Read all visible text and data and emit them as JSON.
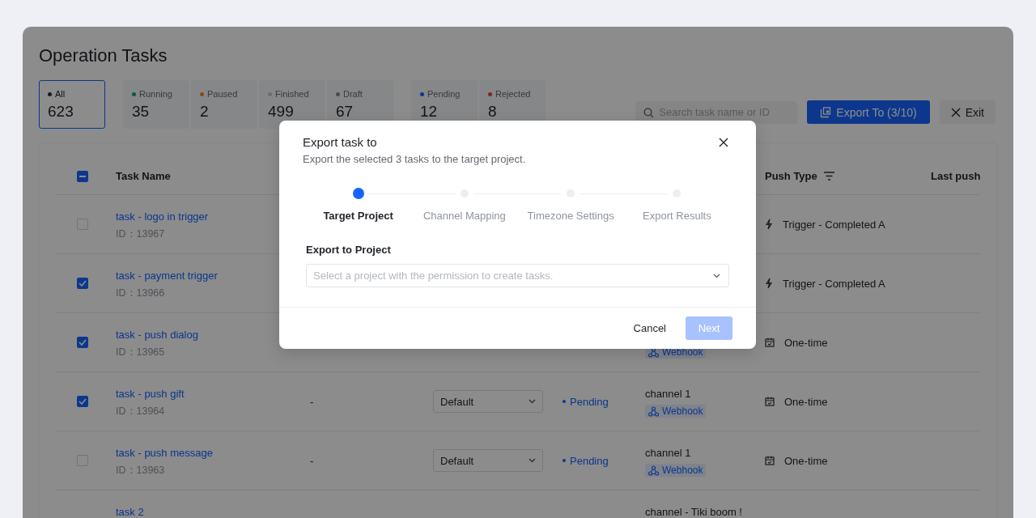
{
  "page": {
    "title": "Operation Tasks"
  },
  "stat_groups": [
    [
      {
        "label": "All",
        "count": "623",
        "color": "#1c1c1c",
        "selected": true
      }
    ],
    [
      {
        "label": "Running",
        "count": "35",
        "color": "#0e5a3b",
        "selected": false
      },
      {
        "label": "Paused",
        "count": "2",
        "color": "#844c14",
        "selected": false
      },
      {
        "label": "Finished",
        "count": "499",
        "color": "#6c6d70",
        "selected": false
      },
      {
        "label": "Draft",
        "count": "67",
        "color": "#4a4b4e",
        "selected": false
      }
    ],
    [
      {
        "label": "Pending",
        "count": "12",
        "color": "#0c378c",
        "selected": false
      },
      {
        "label": "Rejected",
        "count": "8",
        "color": "#7e2819",
        "selected": false
      }
    ]
  ],
  "toolbar": {
    "search": {
      "placeholder": "Search task name or ID"
    },
    "export_button": "Export To (3/10)",
    "exit_button": "Exit"
  },
  "table": {
    "header_checkbox": {
      "indeterminate": true
    },
    "columns": [
      {
        "label": "Task Name",
        "filter": false
      },
      {
        "label": "Push Type",
        "filter": true
      },
      {
        "label": "Last push",
        "filter": false
      }
    ],
    "rows": [
      {
        "selected": false,
        "name": "task - logo in trigger",
        "id": "ID：13967",
        "push_type": {
          "kind": "trigger",
          "label": "Trigger - Completed A"
        }
      },
      {
        "selected": true,
        "name": "task - payment trigger",
        "id": "ID：13966",
        "push_type": {
          "kind": "trigger",
          "label": "Trigger - Completed A"
        }
      },
      {
        "selected": true,
        "name": "task - push dialog",
        "id": "ID：13965",
        "channel_tag": "Webhook",
        "push_type": {
          "kind": "one-time",
          "label": "One-time"
        }
      },
      {
        "selected": true,
        "name": "task - push gift",
        "id": "ID：13964",
        "column_3": "-",
        "group": "Default",
        "status": "Pending",
        "channel": "channel 1",
        "channel_tag": "Webhook",
        "push_type": {
          "kind": "one-time",
          "label": "One-time"
        }
      },
      {
        "selected": false,
        "name": "task - push message",
        "id": "ID：13963",
        "column_3": "-",
        "group": "Default",
        "status": "Pending",
        "channel": "channel 1",
        "channel_tag": "Webhook",
        "push_type": {
          "kind": "one-time",
          "label": "One-time"
        }
      },
      {
        "name": "task 2",
        "channel": "channel - Tiki boom !"
      }
    ]
  },
  "dialog": {
    "title": "Export task to",
    "subtitle": "Export the selected 3 tasks to the target project.",
    "steps": [
      {
        "label": "Target Project",
        "selected": true
      },
      {
        "label": "Channel Mapping",
        "selected": false
      },
      {
        "label": "Timezone Settings",
        "selected": false
      },
      {
        "label": "Export Results",
        "selected": false
      }
    ],
    "field_label": "Export to Project",
    "select": {
      "placeholder": "Select a project with the permission to create tasks."
    },
    "cancel_button": "Cancel",
    "next_button": {
      "label": "Next",
      "disabled": true
    }
  }
}
